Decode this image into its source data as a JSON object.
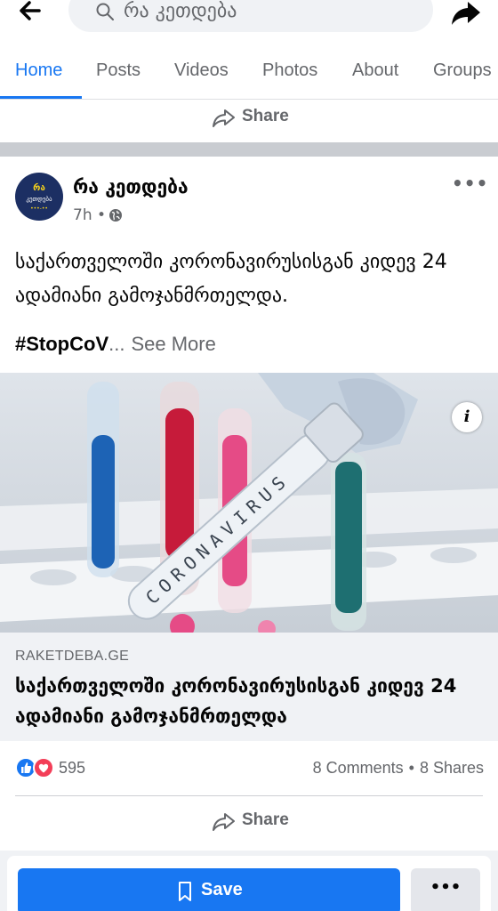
{
  "top_bar": {
    "search_text": "რა კეთდება",
    "back_icon": "arrow-left-icon",
    "share_icon": "share-arrow-icon"
  },
  "tabs": [
    {
      "label": "Home",
      "active": true
    },
    {
      "label": "Posts",
      "active": false
    },
    {
      "label": "Videos",
      "active": false
    },
    {
      "label": "Photos",
      "active": false
    },
    {
      "label": "About",
      "active": false
    },
    {
      "label": "Groups",
      "active": false
    }
  ],
  "previous_post": {
    "share_label": "Share"
  },
  "post": {
    "avatar_text": [
      "რა",
      "კეთდება",
      "•••-••"
    ],
    "page_name": "რა კეთდება",
    "time": "7h •",
    "text": "საქართველოში კორონავირუსისგან კიდევ 24 ადამიანი გამოჯანმრთელდა.",
    "hashtag": "#StopCoV",
    "ellipsis": "...",
    "see_more": "See More",
    "image_text": "CORONAVIRUS",
    "link": {
      "domain": "RAKETDEBA.GE",
      "title": "საქართველოში კორონავირუსისგან კიდევ 24 ადამიანი გამოჯანმრთელდა"
    },
    "reactions": {
      "count": "595"
    },
    "comments": "8 Comments",
    "shares": "8 Shares",
    "share_label": "Share"
  },
  "bottom_bar": {
    "save_label": "Save",
    "menu_label": "•••"
  },
  "colors": {
    "accent": "#1877f2",
    "love": "#f33e58",
    "secondary_text": "#65676b"
  }
}
